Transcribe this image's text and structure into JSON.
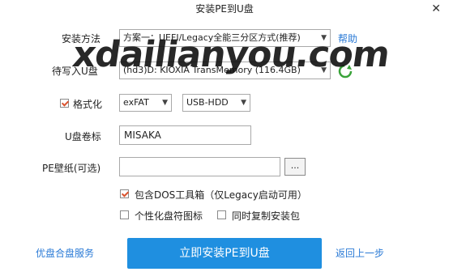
{
  "window": {
    "title": "安装PE到U盘"
  },
  "install_method": {
    "label": "安装方法",
    "value": "方案一：UEFI/Legacy全能三分区方式(推荐)",
    "help": "帮助"
  },
  "target_drive": {
    "label": "待写入U盘",
    "value": "(hd3)D: KIOXIA TransMemory (116.4GB)"
  },
  "format": {
    "label": "格式化",
    "checked": true,
    "fs": "exFAT",
    "mode": "USB-HDD"
  },
  "volume_label": {
    "label": "U盘卷标",
    "value": "MISAKA"
  },
  "wallpaper": {
    "label": "PE壁纸(可选)",
    "value": "",
    "browse": "..."
  },
  "options": {
    "dos_tools": "包含DOS工具箱（仅Legacy启动可用）",
    "custom_icon": "个性化盘符图标",
    "copy_installer": "同时复制安装包"
  },
  "footer": {
    "left_link": "优盘合盘服务",
    "primary": "立即安装PE到U盘",
    "back": "返回上一步"
  },
  "watermark": {
    "text": "xdailianyou.com"
  },
  "colors": {
    "accent": "#1f8fe0",
    "link": "#2a7ad6",
    "check": "#d9532f"
  }
}
